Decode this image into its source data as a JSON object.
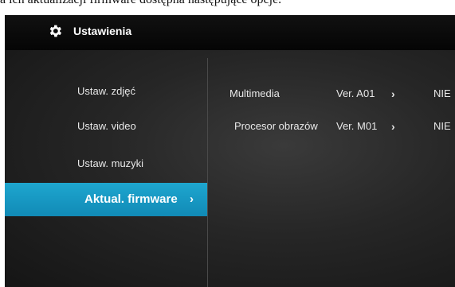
{
  "doc_text": "a ich aktualizacji firmware dostępna następujące opcje.",
  "header": {
    "title": "Ustawienia",
    "icon": "gear-icon"
  },
  "menu": {
    "items": [
      {
        "label": "Ustaw. zdjęć",
        "active": false
      },
      {
        "label": "Ustaw. video",
        "active": false
      },
      {
        "label": "Ustaw. muzyki",
        "active": false
      },
      {
        "label": "Aktual. firmware",
        "active": true,
        "chevron": "›"
      }
    ]
  },
  "firmware": {
    "rows": [
      {
        "name": "Multimedia",
        "version": "Ver. A01",
        "arrow": "›",
        "value": "NIE"
      },
      {
        "name": "Procesor obrazów",
        "version": "Ver. M01",
        "arrow": "›",
        "value": "NIE"
      }
    ]
  },
  "colors": {
    "accent": "#1ea6cf",
    "background": "#262626"
  }
}
